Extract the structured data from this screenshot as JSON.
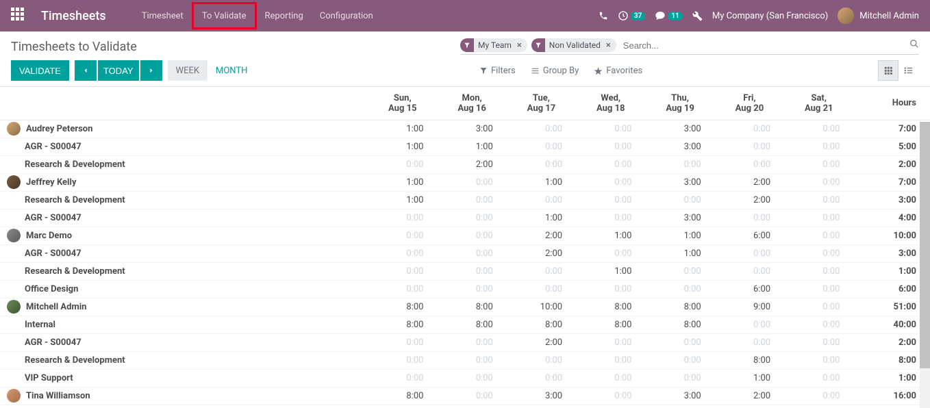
{
  "navbar": {
    "brand": "Timesheets",
    "menu": [
      {
        "label": "Timesheet"
      },
      {
        "label": "To Validate"
      },
      {
        "label": "Reporting"
      },
      {
        "label": "Configuration"
      }
    ],
    "badges": {
      "calls": "37",
      "msgs": "11"
    },
    "company": "My Company (San Francisco)",
    "user": "Mitchell Admin"
  },
  "control": {
    "title": "Timesheets to Validate",
    "facets": [
      {
        "label": "My Team"
      },
      {
        "label": "Non Validated"
      }
    ],
    "search_placeholder": "Search...",
    "validate": "VALIDATE",
    "today": "TODAY",
    "range_week": "WEEK",
    "range_month": "MONTH",
    "filters": "Filters",
    "group_by": "Group By",
    "favorites": "Favorites"
  },
  "columns": {
    "hours": "Hours",
    "days": [
      {
        "dow": "Sun,",
        "date": "Aug 15"
      },
      {
        "dow": "Mon,",
        "date": "Aug 16"
      },
      {
        "dow": "Tue,",
        "date": "Aug 17"
      },
      {
        "dow": "Wed,",
        "date": "Aug 18"
      },
      {
        "dow": "Thu,",
        "date": "Aug 19"
      },
      {
        "dow": "Fri,",
        "date": "Aug 20"
      },
      {
        "dow": "Sat,",
        "date": "Aug 21"
      }
    ]
  },
  "rows": [
    {
      "type": "employee",
      "name": "Audrey Peterson",
      "avatar": "linear-gradient(135deg,#d4a574,#8b6f47)",
      "vals": [
        "1:00",
        "3:00",
        "0:00",
        "0:00",
        "3:00",
        "0:00",
        "0:00"
      ],
      "total": "7:00"
    },
    {
      "type": "task",
      "name": "AGR - S00047",
      "vals": [
        "1:00",
        "1:00",
        "0:00",
        "0:00",
        "3:00",
        "0:00",
        "0:00"
      ],
      "total": "5:00"
    },
    {
      "type": "task",
      "name": "Research & Development",
      "vals": [
        "0:00",
        "2:00",
        "0:00",
        "0:00",
        "0:00",
        "0:00",
        "0:00"
      ],
      "total": "2:00"
    },
    {
      "type": "employee",
      "name": "Jeffrey Kelly",
      "avatar": "linear-gradient(135deg,#7a5c3d,#4a3826)",
      "vals": [
        "1:00",
        "0:00",
        "1:00",
        "0:00",
        "3:00",
        "2:00",
        "0:00"
      ],
      "total": "7:00"
    },
    {
      "type": "task",
      "name": "Research & Development",
      "vals": [
        "1:00",
        "0:00",
        "0:00",
        "0:00",
        "0:00",
        "2:00",
        "0:00"
      ],
      "total": "3:00"
    },
    {
      "type": "task",
      "name": "AGR - S00047",
      "vals": [
        "0:00",
        "0:00",
        "1:00",
        "0:00",
        "3:00",
        "0:00",
        "0:00"
      ],
      "total": "4:00"
    },
    {
      "type": "employee",
      "name": "Marc Demo",
      "avatar": "linear-gradient(135deg,#8a8a8a,#5a5a5a)",
      "vals": [
        "0:00",
        "0:00",
        "2:00",
        "1:00",
        "1:00",
        "6:00",
        "0:00"
      ],
      "total": "10:00"
    },
    {
      "type": "task",
      "name": "AGR - S00047",
      "vals": [
        "0:00",
        "0:00",
        "2:00",
        "0:00",
        "1:00",
        "0:00",
        "0:00"
      ],
      "total": "3:00"
    },
    {
      "type": "task",
      "name": "Research & Development",
      "vals": [
        "0:00",
        "0:00",
        "0:00",
        "1:00",
        "0:00",
        "0:00",
        "0:00"
      ],
      "total": "1:00"
    },
    {
      "type": "task",
      "name": "Office Design",
      "vals": [
        "0:00",
        "0:00",
        "0:00",
        "0:00",
        "0:00",
        "6:00",
        "0:00"
      ],
      "total": "6:00"
    },
    {
      "type": "employee",
      "name": "Mitchell Admin",
      "avatar": "linear-gradient(135deg,#6b8a5a,#3e5634)",
      "vals": [
        "8:00",
        "8:00",
        "10:00",
        "8:00",
        "8:00",
        "9:00",
        "0:00"
      ],
      "total": "51:00"
    },
    {
      "type": "task",
      "name": "Internal",
      "vals": [
        "8:00",
        "8:00",
        "8:00",
        "8:00",
        "8:00",
        "0:00",
        "0:00"
      ],
      "total": "40:00"
    },
    {
      "type": "task",
      "name": "AGR - S00047",
      "vals": [
        "0:00",
        "0:00",
        "2:00",
        "0:00",
        "0:00",
        "0:00",
        "0:00"
      ],
      "total": "2:00"
    },
    {
      "type": "task",
      "name": "Research & Development",
      "vals": [
        "0:00",
        "0:00",
        "0:00",
        "0:00",
        "0:00",
        "8:00",
        "0:00"
      ],
      "total": "8:00"
    },
    {
      "type": "task",
      "name": "VIP Support",
      "vals": [
        "0:00",
        "0:00",
        "0:00",
        "0:00",
        "0:00",
        "1:00",
        "0:00"
      ],
      "total": "1:00"
    },
    {
      "type": "employee",
      "name": "Tina Williamson",
      "avatar": "linear-gradient(135deg,#d49a74,#a86b47)",
      "vals": [
        "8:00",
        "0:00",
        "3:00",
        "0:00",
        "3:00",
        "2:00",
        "0:00"
      ],
      "total": "16:00"
    }
  ]
}
